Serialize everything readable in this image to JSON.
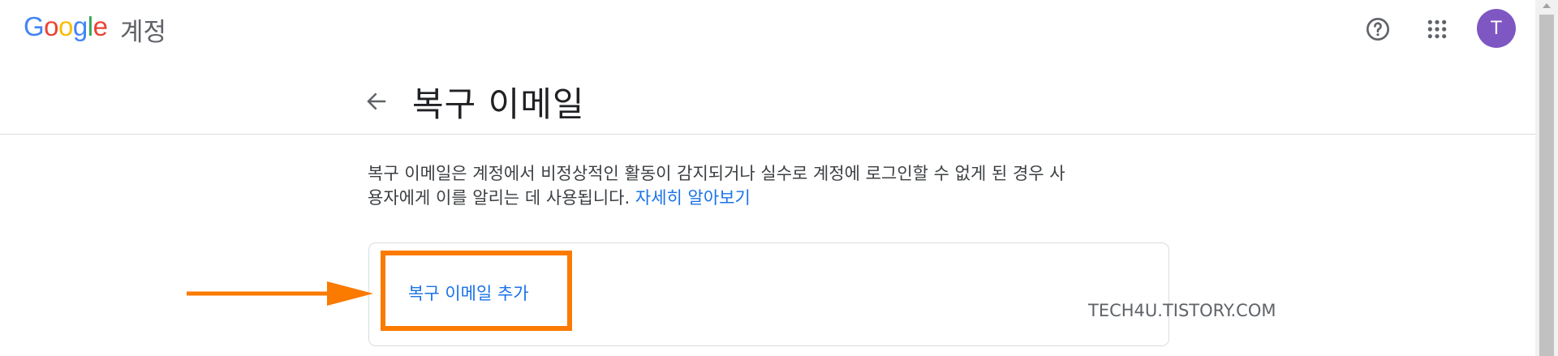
{
  "header": {
    "logo_letters": [
      {
        "char": "G",
        "color": "#4285F4"
      },
      {
        "char": "o",
        "color": "#EA4335"
      },
      {
        "char": "o",
        "color": "#FBBC05"
      },
      {
        "char": "g",
        "color": "#4285F4"
      },
      {
        "char": "l",
        "color": "#34A853"
      },
      {
        "char": "e",
        "color": "#EA4335"
      }
    ],
    "product_name": "계정",
    "help_icon": "help-circle-icon",
    "apps_icon": "apps-grid-icon",
    "avatar_letter": "T",
    "avatar_color": "#7E57C2"
  },
  "page": {
    "back_icon": "arrow-back-icon",
    "title": "복구 이메일",
    "description_line1": "복구 이메일은 계정에서 비정상적인 활동이 감지되거나 실수로 계정에 로그인할 수 없게 된 경우 사",
    "description_line2": "용자에게 이를 알리는 데 사용됩니다.",
    "learn_more": "자세히 알아보기",
    "add_recovery_email": "복구 이메일 추가",
    "link_color": "#1A73E8"
  },
  "annotation": {
    "highlight_color": "#FB7A00",
    "arrow_icon": "right-arrow-annotation-icon",
    "watermark": "TECH4U.TISTORY.COM"
  }
}
